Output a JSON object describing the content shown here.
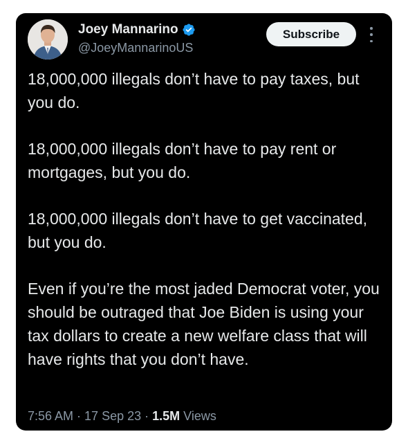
{
  "author": {
    "display_name": "Joey Mannarino",
    "handle": "@JoeyMannarinoUS",
    "verified": true,
    "verified_color": "#1d9bf0",
    "avatar_icon": "person-in-suit-avatar"
  },
  "actions": {
    "subscribe_label": "Subscribe",
    "more_icon": "more-vertical-icon"
  },
  "tweet": {
    "paragraphs": [
      "18,000,000 illegals don’t have to pay taxes, but you do.",
      "18,000,000 illegals don’t have to pay rent or mortgages, but you do.",
      "18,000,000 illegals don’t have to get vaccinated, but you do.",
      "Even if you’re the most jaded Democrat voter, you should be outraged that Joe Biden is using your tax dollars to create a new welfare class that will have rights that you don’t have."
    ]
  },
  "meta": {
    "time": "7:56 AM",
    "separator": " · ",
    "date": "17 Sep 23",
    "views_count": "1.5M",
    "views_label": " Views"
  },
  "colors": {
    "card_background": "#000000",
    "text_primary": "#e7e9ea",
    "text_secondary": "#8b98a5",
    "button_background": "#eff3f4"
  }
}
